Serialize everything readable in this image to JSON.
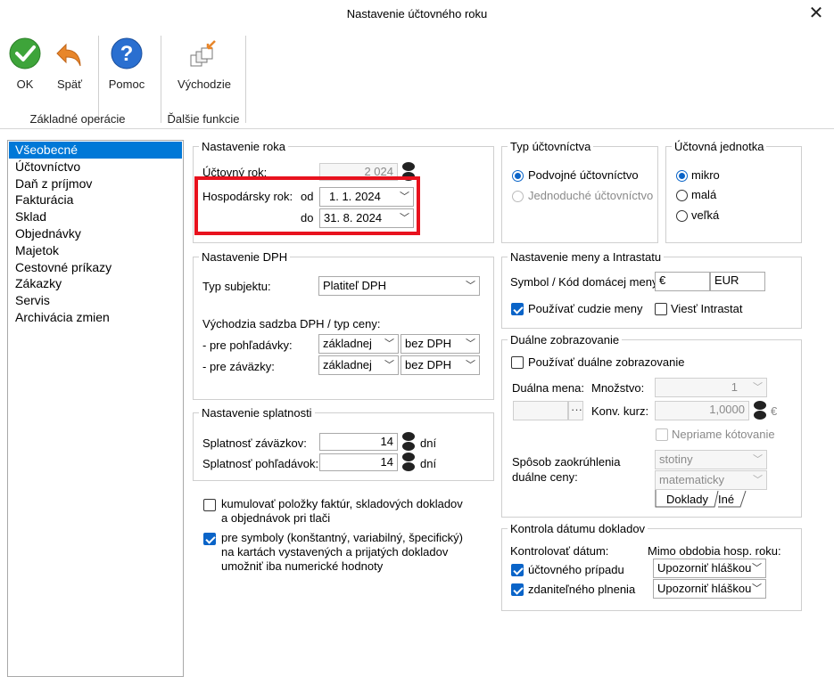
{
  "window": {
    "title": "Nastavenie účtovného roku",
    "close_glyph": "✕"
  },
  "ribbon": {
    "ok": "OK",
    "back": "Späť",
    "help": "Pomoc",
    "defaults": "Východzie",
    "group_basic": "Základné operácie",
    "group_more": "Ďalšie funkcie"
  },
  "nav": {
    "items": [
      "Všeobecné",
      "Účtovníctvo",
      "Daň z príjmov",
      "Fakturácia",
      "Sklad",
      "Objednávky",
      "Majetok",
      "Cestovné príkazy",
      "Zákazky",
      "Servis",
      "Archivácia zmien"
    ],
    "selected": 0
  },
  "year": {
    "legend": "Nastavenie roka",
    "acc_year_label": "Účtovný rok:",
    "acc_year_value": "2 024",
    "fiscal_label": "Hospodársky rok:",
    "from_label": "od",
    "from_value": "1.  1. 2024",
    "to_label": "do",
    "to_value": "31.  8. 2024"
  },
  "acc_type": {
    "legend": "Typ účtovníctva",
    "double": "Podvojné účtovníctvo",
    "single": "Jednoduché účtovníctvo"
  },
  "acc_unit": {
    "legend": "Účtovná jednotka",
    "micro": "mikro",
    "small": "malá",
    "large": "veľká"
  },
  "vat": {
    "legend": "Nastavenie DPH",
    "subject_label": "Typ subjektu:",
    "subject_value": "Platiteľ DPH",
    "default_rate_label": "Východzia sadzba DPH / typ ceny:",
    "receivables_label": "- pre pohľadávky:",
    "payables_label": "- pre záväzky:",
    "rate_value": "základnej",
    "price_value": "bez DPH"
  },
  "due": {
    "legend": "Nastavenie splatnosti",
    "payables_label": "Splatnosť záväzkov:",
    "payables_value": "14",
    "receivables_label": "Splatnosť pohľadávok:",
    "receivables_value": "14",
    "unit": "dní"
  },
  "options": {
    "cumulate": "kumulovať položky faktúr, skladových dokladov a objednávok pri tlači",
    "symbols": "pre symboly (konštantný, variabilný, špecifický) na kartách vystavených a prijatých dokladov umožniť iba numerické hodnoty"
  },
  "currency": {
    "legend": "Nastavenie meny a Intrastatu",
    "symbol_label": "Symbol / Kód domácej meny:",
    "symbol_value": "€",
    "code_value": "EUR",
    "foreign_label": "Používať cudzie meny",
    "intrastat_label": "Viesť Intrastat"
  },
  "dual": {
    "legend": "Duálne zobrazovanie",
    "use_label": "Používať duálne zobrazovanie",
    "currency_label": "Duálna mena:",
    "amount_label": "Množstvo:",
    "amount_value": "1",
    "rate_label": "Konv. kurz:",
    "rate_value": "1,0000",
    "rate_unit": "€",
    "indirect_label": "Nepriame kótovanie",
    "rounding_label_1": "Spôsob zaokrúhlenia",
    "rounding_label_2": "duálne ceny:",
    "rounding_value": "stotiny",
    "method_value": "matematicky",
    "tab_docs": "Doklady",
    "tab_other": "Iné",
    "ellipsis": "···"
  },
  "date_check": {
    "legend": "Kontrola dátumu dokladov",
    "check_label": "Kontrolovať dátum:",
    "outside_label": "Mimo obdobia hosp. roku:",
    "acc_case": "účtovného prípadu",
    "taxable": "zdaniteľného plnenia",
    "warn_value": "Upozorniť hláškou"
  }
}
